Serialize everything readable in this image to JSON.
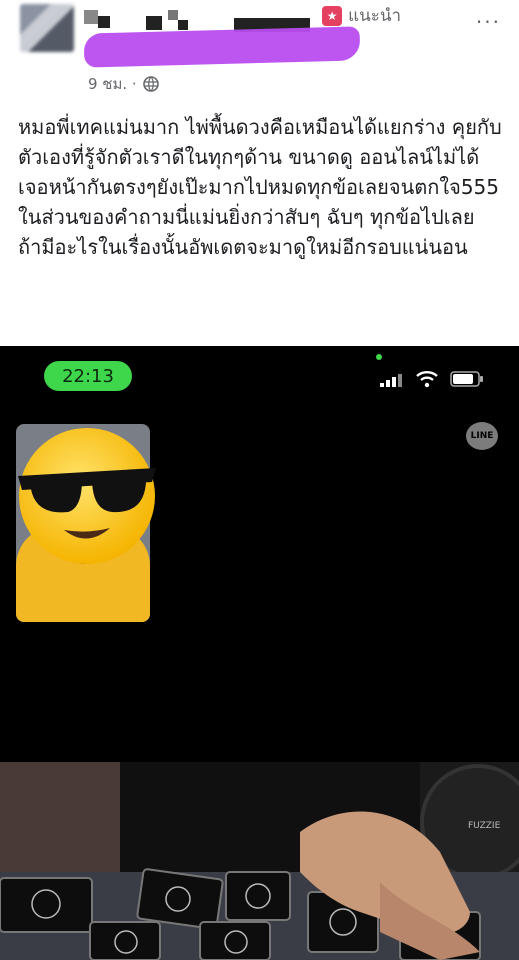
{
  "post": {
    "time_label": "9 ชม. ·",
    "suggest_label": "แนะนำ",
    "more_label": "...",
    "text": "หมอพี่เทคแม่นมาก ไพ่พื้นดวงคือเหมือนได้แยกร่าง คุยกับตัวเองที่รู้จักตัวเราดีในทุกๆด้าน ขนาดดู ออนไลน์ไม่ได้เจอหน้ากันตรงๆยังเป๊ะมากไปหมดทุกข้อเลยจนตกใจ555 ในส่วนของคำถามนี่แม่นยิ่งกว่าสับๆ ฉับๆ ทุกข้อไปเลย ถ้ามีอะไรในเรื่องนั้นอัพเดตจะมาดูใหม่อีกรอบแน่นอน"
  },
  "call": {
    "status_time": "22:13",
    "app_badge": "LINE",
    "fan_brand": "FUZZIE"
  },
  "icons": {
    "globe": "globe-icon",
    "suggest": "suggest-icon",
    "signal": "signal-icon",
    "wifi": "wifi-icon",
    "battery": "battery-icon",
    "emoji": "sunglasses-emoji"
  },
  "colors": {
    "scribble": "#b94df0",
    "status_pill": "#3ed64a",
    "background_call": "#000000"
  }
}
